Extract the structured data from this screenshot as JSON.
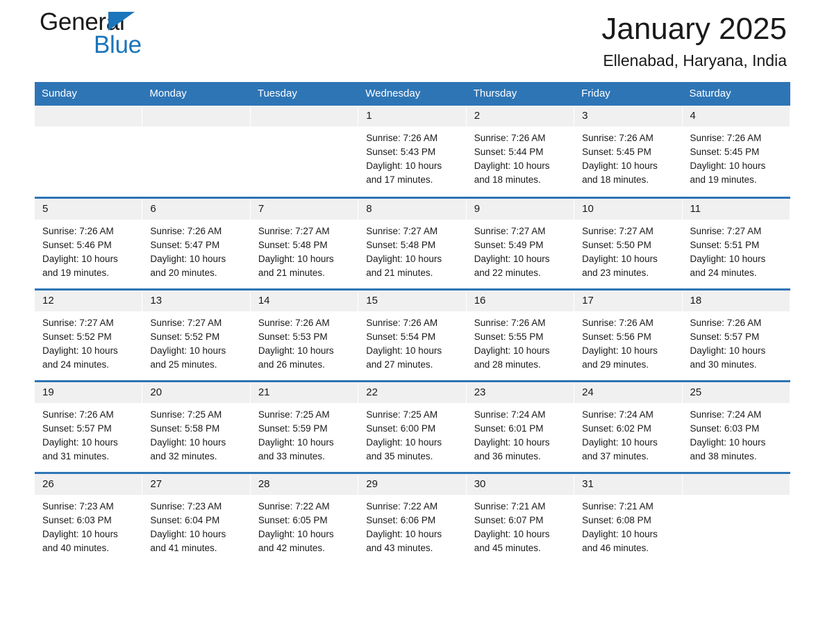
{
  "brand": {
    "line1": "General",
    "line2": "Blue",
    "triangle_color": "#1a75bb"
  },
  "header": {
    "title": "January 2025",
    "subtitle": "Ellenabad, Haryana, India"
  },
  "theme": {
    "header_blue": "#2e75b6",
    "daynum_band": "#f0f0f0",
    "text": "#1a1a1a"
  },
  "weekdays": [
    "Sunday",
    "Monday",
    "Tuesday",
    "Wednesday",
    "Thursday",
    "Friday",
    "Saturday"
  ],
  "weeks": [
    [
      {
        "day": "",
        "sunrise": "",
        "sunset": "",
        "daylight_line1": "",
        "daylight_line2": "",
        "empty": true
      },
      {
        "day": "",
        "sunrise": "",
        "sunset": "",
        "daylight_line1": "",
        "daylight_line2": "",
        "empty": true
      },
      {
        "day": "",
        "sunrise": "",
        "sunset": "",
        "daylight_line1": "",
        "daylight_line2": "",
        "empty": true
      },
      {
        "day": "1",
        "sunrise": "Sunrise: 7:26 AM",
        "sunset": "Sunset: 5:43 PM",
        "daylight_line1": "Daylight: 10 hours",
        "daylight_line2": "and 17 minutes.",
        "empty": false
      },
      {
        "day": "2",
        "sunrise": "Sunrise: 7:26 AM",
        "sunset": "Sunset: 5:44 PM",
        "daylight_line1": "Daylight: 10 hours",
        "daylight_line2": "and 18 minutes.",
        "empty": false
      },
      {
        "day": "3",
        "sunrise": "Sunrise: 7:26 AM",
        "sunset": "Sunset: 5:45 PM",
        "daylight_line1": "Daylight: 10 hours",
        "daylight_line2": "and 18 minutes.",
        "empty": false
      },
      {
        "day": "4",
        "sunrise": "Sunrise: 7:26 AM",
        "sunset": "Sunset: 5:45 PM",
        "daylight_line1": "Daylight: 10 hours",
        "daylight_line2": "and 19 minutes.",
        "empty": false
      }
    ],
    [
      {
        "day": "5",
        "sunrise": "Sunrise: 7:26 AM",
        "sunset": "Sunset: 5:46 PM",
        "daylight_line1": "Daylight: 10 hours",
        "daylight_line2": "and 19 minutes.",
        "empty": false
      },
      {
        "day": "6",
        "sunrise": "Sunrise: 7:26 AM",
        "sunset": "Sunset: 5:47 PM",
        "daylight_line1": "Daylight: 10 hours",
        "daylight_line2": "and 20 minutes.",
        "empty": false
      },
      {
        "day": "7",
        "sunrise": "Sunrise: 7:27 AM",
        "sunset": "Sunset: 5:48 PM",
        "daylight_line1": "Daylight: 10 hours",
        "daylight_line2": "and 21 minutes.",
        "empty": false
      },
      {
        "day": "8",
        "sunrise": "Sunrise: 7:27 AM",
        "sunset": "Sunset: 5:48 PM",
        "daylight_line1": "Daylight: 10 hours",
        "daylight_line2": "and 21 minutes.",
        "empty": false
      },
      {
        "day": "9",
        "sunrise": "Sunrise: 7:27 AM",
        "sunset": "Sunset: 5:49 PM",
        "daylight_line1": "Daylight: 10 hours",
        "daylight_line2": "and 22 minutes.",
        "empty": false
      },
      {
        "day": "10",
        "sunrise": "Sunrise: 7:27 AM",
        "sunset": "Sunset: 5:50 PM",
        "daylight_line1": "Daylight: 10 hours",
        "daylight_line2": "and 23 minutes.",
        "empty": false
      },
      {
        "day": "11",
        "sunrise": "Sunrise: 7:27 AM",
        "sunset": "Sunset: 5:51 PM",
        "daylight_line1": "Daylight: 10 hours",
        "daylight_line2": "and 24 minutes.",
        "empty": false
      }
    ],
    [
      {
        "day": "12",
        "sunrise": "Sunrise: 7:27 AM",
        "sunset": "Sunset: 5:52 PM",
        "daylight_line1": "Daylight: 10 hours",
        "daylight_line2": "and 24 minutes.",
        "empty": false
      },
      {
        "day": "13",
        "sunrise": "Sunrise: 7:27 AM",
        "sunset": "Sunset: 5:52 PM",
        "daylight_line1": "Daylight: 10 hours",
        "daylight_line2": "and 25 minutes.",
        "empty": false
      },
      {
        "day": "14",
        "sunrise": "Sunrise: 7:26 AM",
        "sunset": "Sunset: 5:53 PM",
        "daylight_line1": "Daylight: 10 hours",
        "daylight_line2": "and 26 minutes.",
        "empty": false
      },
      {
        "day": "15",
        "sunrise": "Sunrise: 7:26 AM",
        "sunset": "Sunset: 5:54 PM",
        "daylight_line1": "Daylight: 10 hours",
        "daylight_line2": "and 27 minutes.",
        "empty": false
      },
      {
        "day": "16",
        "sunrise": "Sunrise: 7:26 AM",
        "sunset": "Sunset: 5:55 PM",
        "daylight_line1": "Daylight: 10 hours",
        "daylight_line2": "and 28 minutes.",
        "empty": false
      },
      {
        "day": "17",
        "sunrise": "Sunrise: 7:26 AM",
        "sunset": "Sunset: 5:56 PM",
        "daylight_line1": "Daylight: 10 hours",
        "daylight_line2": "and 29 minutes.",
        "empty": false
      },
      {
        "day": "18",
        "sunrise": "Sunrise: 7:26 AM",
        "sunset": "Sunset: 5:57 PM",
        "daylight_line1": "Daylight: 10 hours",
        "daylight_line2": "and 30 minutes.",
        "empty": false
      }
    ],
    [
      {
        "day": "19",
        "sunrise": "Sunrise: 7:26 AM",
        "sunset": "Sunset: 5:57 PM",
        "daylight_line1": "Daylight: 10 hours",
        "daylight_line2": "and 31 minutes.",
        "empty": false
      },
      {
        "day": "20",
        "sunrise": "Sunrise: 7:25 AM",
        "sunset": "Sunset: 5:58 PM",
        "daylight_line1": "Daylight: 10 hours",
        "daylight_line2": "and 32 minutes.",
        "empty": false
      },
      {
        "day": "21",
        "sunrise": "Sunrise: 7:25 AM",
        "sunset": "Sunset: 5:59 PM",
        "daylight_line1": "Daylight: 10 hours",
        "daylight_line2": "and 33 minutes.",
        "empty": false
      },
      {
        "day": "22",
        "sunrise": "Sunrise: 7:25 AM",
        "sunset": "Sunset: 6:00 PM",
        "daylight_line1": "Daylight: 10 hours",
        "daylight_line2": "and 35 minutes.",
        "empty": false
      },
      {
        "day": "23",
        "sunrise": "Sunrise: 7:24 AM",
        "sunset": "Sunset: 6:01 PM",
        "daylight_line1": "Daylight: 10 hours",
        "daylight_line2": "and 36 minutes.",
        "empty": false
      },
      {
        "day": "24",
        "sunrise": "Sunrise: 7:24 AM",
        "sunset": "Sunset: 6:02 PM",
        "daylight_line1": "Daylight: 10 hours",
        "daylight_line2": "and 37 minutes.",
        "empty": false
      },
      {
        "day": "25",
        "sunrise": "Sunrise: 7:24 AM",
        "sunset": "Sunset: 6:03 PM",
        "daylight_line1": "Daylight: 10 hours",
        "daylight_line2": "and 38 minutes.",
        "empty": false
      }
    ],
    [
      {
        "day": "26",
        "sunrise": "Sunrise: 7:23 AM",
        "sunset": "Sunset: 6:03 PM",
        "daylight_line1": "Daylight: 10 hours",
        "daylight_line2": "and 40 minutes.",
        "empty": false
      },
      {
        "day": "27",
        "sunrise": "Sunrise: 7:23 AM",
        "sunset": "Sunset: 6:04 PM",
        "daylight_line1": "Daylight: 10 hours",
        "daylight_line2": "and 41 minutes.",
        "empty": false
      },
      {
        "day": "28",
        "sunrise": "Sunrise: 7:22 AM",
        "sunset": "Sunset: 6:05 PM",
        "daylight_line1": "Daylight: 10 hours",
        "daylight_line2": "and 42 minutes.",
        "empty": false
      },
      {
        "day": "29",
        "sunrise": "Sunrise: 7:22 AM",
        "sunset": "Sunset: 6:06 PM",
        "daylight_line1": "Daylight: 10 hours",
        "daylight_line2": "and 43 minutes.",
        "empty": false
      },
      {
        "day": "30",
        "sunrise": "Sunrise: 7:21 AM",
        "sunset": "Sunset: 6:07 PM",
        "daylight_line1": "Daylight: 10 hours",
        "daylight_line2": "and 45 minutes.",
        "empty": false
      },
      {
        "day": "31",
        "sunrise": "Sunrise: 7:21 AM",
        "sunset": "Sunset: 6:08 PM",
        "daylight_line1": "Daylight: 10 hours",
        "daylight_line2": "and 46 minutes.",
        "empty": false
      },
      {
        "day": "",
        "sunrise": "",
        "sunset": "",
        "daylight_line1": "",
        "daylight_line2": "",
        "empty": true
      }
    ]
  ]
}
